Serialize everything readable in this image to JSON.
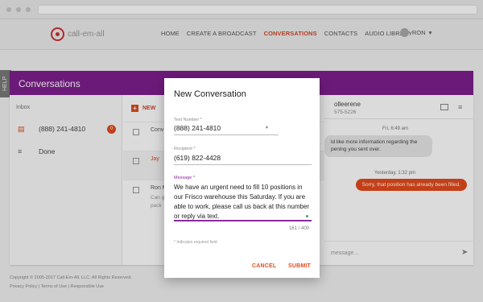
{
  "nav": {
    "logo_text": "call-em-all",
    "links": [
      "HOME",
      "CREATE A BROADCAST",
      "CONVERSATIONS",
      "CONTACTS",
      "AUDIO LIBRARY"
    ],
    "active_index": 2,
    "user": "RON"
  },
  "help_tab": "HELP",
  "conversations": {
    "title": "Conversations",
    "inbox_label": "Inbox",
    "inbox_number": "(888) 241-4810",
    "inbox_badge": "0",
    "done_label": "Done",
    "new_label": "NEW",
    "rows": [
      {
        "name": "Conv",
        "preview": ""
      },
      {
        "name": "Jay",
        "preview": ""
      },
      {
        "name": "Ron M",
        "preview": "Can g"
      },
      {
        "name": "",
        "preview": "pack"
      }
    ]
  },
  "thread": {
    "contact_name": "olleerene",
    "contact_number": "575-5226",
    "time1": "Fri, 6:49 am",
    "incoming": "ld like more information regarding the\npening you sent over.",
    "time2": "Yesterday, 1:32 pm",
    "outgoing": "Sorry, that position has already been filled.",
    "type_placeholder": "message..."
  },
  "footer": {
    "copyright": "Copyright © 2005-2017 Call-Em-All, LLC. All Rights Reserved.",
    "links": "Privacy Policy | Terms of Use | Responsible Use"
  },
  "modal": {
    "title": "New Conversation",
    "text_number_label": "Text Number *",
    "text_number_value": "(888) 241-4810",
    "recipient_label": "Recipient *",
    "recipient_value": "(619) 822-4428",
    "message_label": "Message *",
    "message_value": "We have an urgent need to fill 10 positions in our Frisco warehouse this Saturday. If you are able to work, please call us back at this number or reply via text.",
    "counter": "161 / 400",
    "required_note": "* Indicates required field",
    "cancel_label": "CANCEL",
    "submit_label": "SUBMIT"
  }
}
